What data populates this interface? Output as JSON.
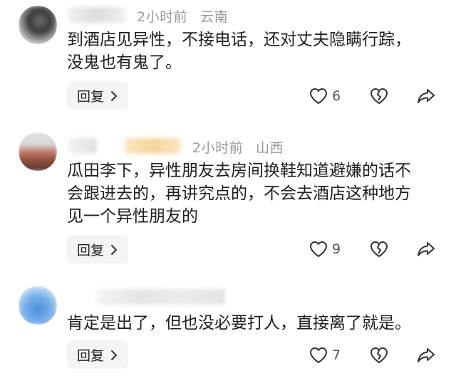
{
  "comments": [
    {
      "time": "2小时前",
      "location": "云南",
      "lines": [
        "到酒店见异性，不接电话，还对丈夫隐瞒行踪，",
        "没鬼也有鬼了。"
      ],
      "reply_label": "回复",
      "like_count": "6",
      "avatar_colors": [
        "#3a3a3a",
        "#bdbdbd",
        "#6d6d6d"
      ]
    },
    {
      "time": "2小时前",
      "location": "山西",
      "lines": [
        "瓜田李下，异性朋友去房间换鞋知道避嫌的话不",
        "会跟进去的，再讲究点的，不会去酒店这种地方",
        "见一个异性朋友的"
      ],
      "reply_label": "回复",
      "like_count": "9",
      "avatar_colors": [
        "#d9d9d9",
        "#b86f5a",
        "#5a3b32"
      ]
    },
    {
      "time": "",
      "location": "",
      "lines": [
        "肯定是出了，但也没必要打人，直接离了就是。"
      ],
      "reply_label": "回复",
      "like_count": "7",
      "avatar_colors": [
        "#cfe3f5",
        "#79b1ea",
        "#4a8fd9"
      ]
    }
  ],
  "icons": {
    "like": "heart-icon",
    "dislike": "broken-heart-icon",
    "share": "share-arrow-icon",
    "chevron": "chevron-right-icon"
  }
}
